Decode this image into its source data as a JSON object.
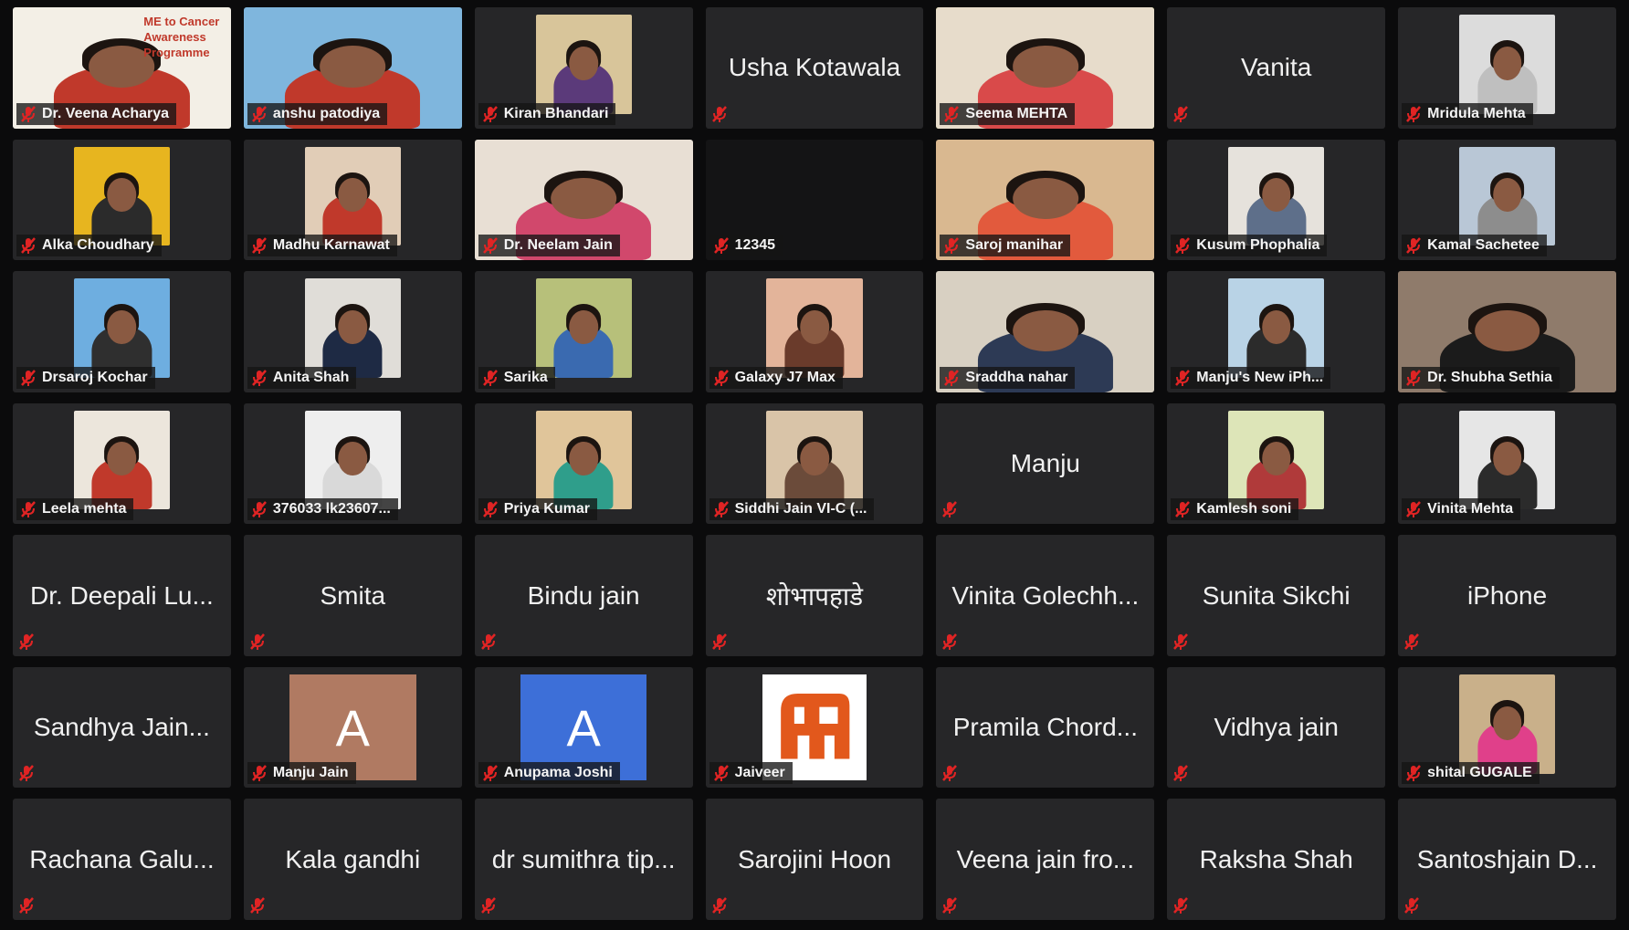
{
  "participants": [
    {
      "name": "Dr. Veena Acharya",
      "type": "video",
      "video": "full",
      "bg": "#f3efe6",
      "shirt": "#c0392b",
      "banner": "ME to Cancer Awareness Programme"
    },
    {
      "name": "anshu patodiya",
      "type": "video",
      "video": "full",
      "bg": "#7fb6dd",
      "shirt": "#c0392b"
    },
    {
      "name": "Kiran Bhandari",
      "type": "video",
      "video": "normal",
      "bg": "#d8c59a",
      "shirt": "#5b3a7a"
    },
    {
      "name": "Usha Kotawala",
      "type": "name"
    },
    {
      "name": "Seema MEHTA",
      "type": "video",
      "video": "full",
      "bg": "#e7dccb",
      "shirt": "#d94a4a",
      "active": true
    },
    {
      "name": "Vanita",
      "type": "name"
    },
    {
      "name": "Mridula Mehta",
      "type": "video",
      "video": "normal",
      "bg": "#dcdcdc",
      "shirt": "#bfbfbf"
    },
    {
      "name": "Alka Choudhary",
      "type": "video",
      "video": "normal",
      "bg": "#e7b51f",
      "shirt": "#2b2b2b"
    },
    {
      "name": "Madhu Karnawat",
      "type": "video",
      "video": "normal",
      "bg": "#e1cdb7",
      "shirt": "#c0392b"
    },
    {
      "name": "Dr. Neelam Jain",
      "type": "video",
      "video": "full",
      "bg": "#e8dfd4",
      "shirt": "#d1486c"
    },
    {
      "name": "12345",
      "type": "black"
    },
    {
      "name": "Saroj manihar",
      "type": "video",
      "video": "full",
      "bg": "#d9b890",
      "shirt": "#e25a3d"
    },
    {
      "name": "Kusum Phophalia",
      "type": "video",
      "video": "normal",
      "bg": "#e6e2dc",
      "shirt": "#5e6f8a"
    },
    {
      "name": "Kamal Sachetee",
      "type": "video",
      "video": "normal",
      "bg": "#b9c7d6",
      "shirt": "#8d8d8d"
    },
    {
      "name": "Drsaroj Kochar",
      "type": "video",
      "video": "normal",
      "bg": "#6eaee0",
      "shirt": "#2f2f2f"
    },
    {
      "name": "Anita Shah",
      "type": "video",
      "video": "normal",
      "bg": "#e0ddd8",
      "shirt": "#1e2a44"
    },
    {
      "name": "Sarika",
      "type": "video",
      "video": "normal",
      "bg": "#b7c07a",
      "shirt": "#3a6ab0"
    },
    {
      "name": "Galaxy J7 Max",
      "type": "video",
      "video": "normal",
      "bg": "#e3b49a",
      "shirt": "#6a3b2b"
    },
    {
      "name": "Sraddha nahar",
      "type": "video",
      "video": "full",
      "bg": "#d8d0c2",
      "shirt": "#2d3a55"
    },
    {
      "name": "Manju's New iPh...",
      "type": "video",
      "video": "normal",
      "bg": "#b9d3e6",
      "shirt": "#2b2b2b"
    },
    {
      "name": "Dr. Shubha Sethia",
      "type": "video",
      "video": "full",
      "bg": "#8f7b6b",
      "shirt": "#1b1b1b"
    },
    {
      "name": "Leela mehta",
      "type": "video",
      "video": "normal",
      "bg": "#ece6dc",
      "shirt": "#c0392b"
    },
    {
      "name": "376033 lk23607...",
      "type": "video",
      "video": "normal",
      "bg": "#eeeeee",
      "shirt": "#d9d9d9"
    },
    {
      "name": "Priya Kumar",
      "type": "video",
      "video": "normal",
      "bg": "#e0c59a",
      "shirt": "#2f9e8b"
    },
    {
      "name": "Siddhi Jain VI-C (...",
      "type": "video",
      "video": "normal",
      "bg": "#d9c4a8",
      "shirt": "#6b4b3a"
    },
    {
      "name": "Manju",
      "type": "name"
    },
    {
      "name": "Kamlesh soni",
      "type": "video",
      "video": "normal",
      "bg": "#dde5b8",
      "shirt": "#b03a3a"
    },
    {
      "name": "Vinita Mehta",
      "type": "video",
      "video": "normal",
      "bg": "#e6e6e6",
      "shirt": "#2b2b2b"
    },
    {
      "name": "Dr. Deepali Lu...",
      "type": "name"
    },
    {
      "name": "Smita",
      "type": "name"
    },
    {
      "name": "Bindu jain",
      "type": "name"
    },
    {
      "name": "शोभापहाडे",
      "type": "name"
    },
    {
      "name": "Vinita Golechh...",
      "type": "name"
    },
    {
      "name": "Sunita Sikchi",
      "type": "name"
    },
    {
      "name": "iPhone",
      "type": "name"
    },
    {
      "name": "Sandhya Jain...",
      "type": "name"
    },
    {
      "name": "Manju Jain",
      "type": "avatar",
      "letter": "A",
      "color": "#b07a62"
    },
    {
      "name": "Anupama Joshi",
      "type": "avatar",
      "letter": "A",
      "color": "#3d6fd8"
    },
    {
      "name": "Jaiveer",
      "type": "logo",
      "logo_color": "#e2581c"
    },
    {
      "name": "Pramila Chord...",
      "type": "name"
    },
    {
      "name": "Vidhya jain",
      "type": "name"
    },
    {
      "name": "shital GUGALE",
      "type": "video",
      "video": "normal",
      "bg": "#c9b08a",
      "shirt": "#e0408a"
    },
    {
      "name": "Rachana Galu...",
      "type": "name"
    },
    {
      "name": "Kala gandhi",
      "type": "name"
    },
    {
      "name": "dr sumithra tip...",
      "type": "name"
    },
    {
      "name": "Sarojini Hoon",
      "type": "name"
    },
    {
      "name": "Veena jain fro...",
      "type": "name"
    },
    {
      "name": "Raksha Shah",
      "type": "name"
    },
    {
      "name": "Santoshjain D...",
      "type": "name"
    }
  ],
  "colors": {
    "mute_icon": "#e02424",
    "active_border": "#c7e34a",
    "tile_bg": "#262628"
  }
}
